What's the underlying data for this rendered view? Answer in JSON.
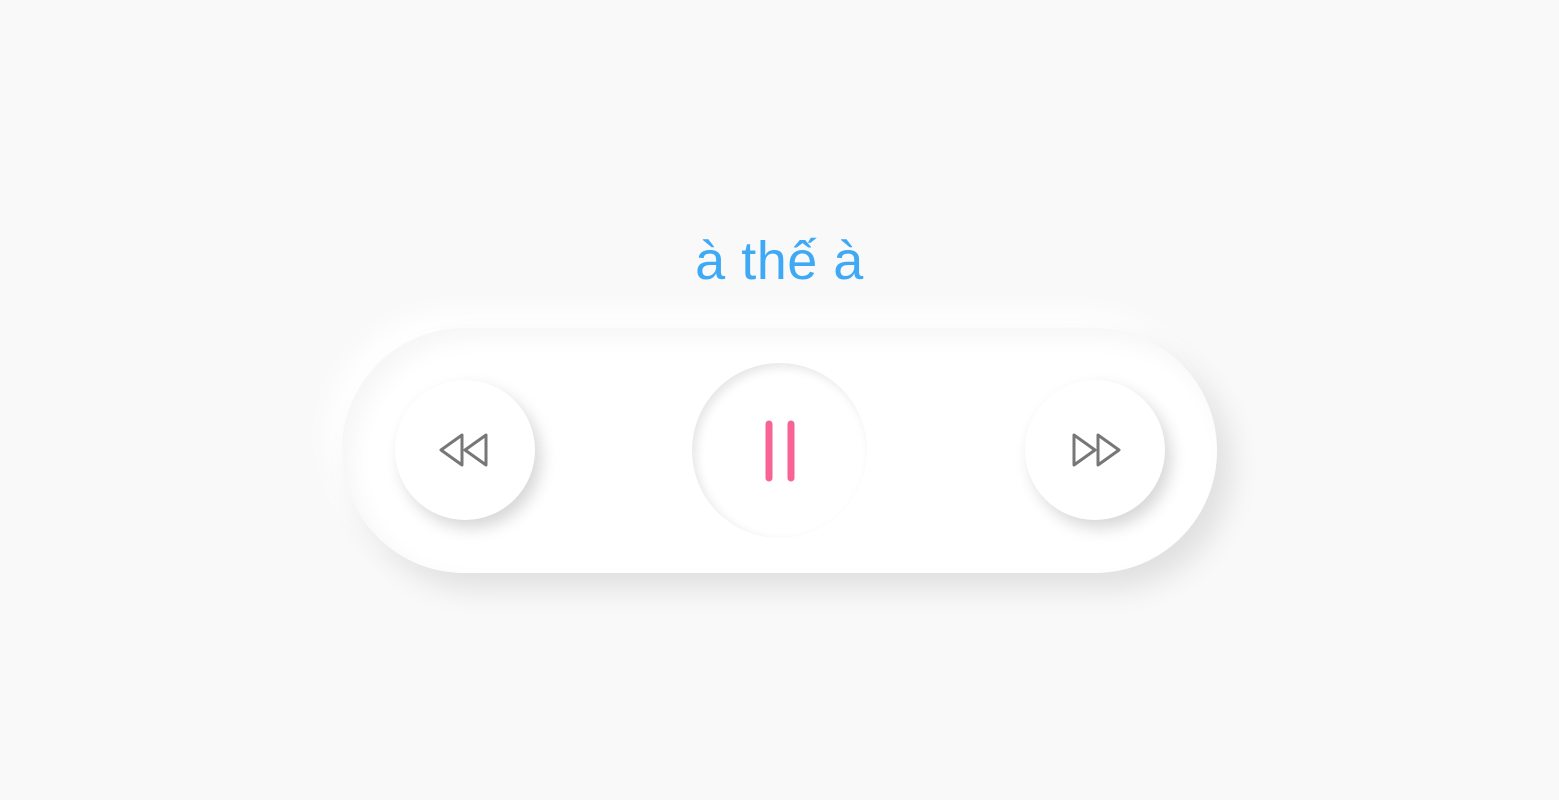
{
  "track": {
    "title": "à thế à"
  },
  "controls": {
    "previous_icon": "rewind-icon",
    "play_pause_icon": "pause-icon",
    "next_icon": "fast-forward-icon"
  },
  "colors": {
    "background": "#f9f9f9",
    "panel": "#ffffff",
    "title": "#3fa9f5",
    "pause_accent": "#f76395",
    "icon_gray": "#777777"
  }
}
